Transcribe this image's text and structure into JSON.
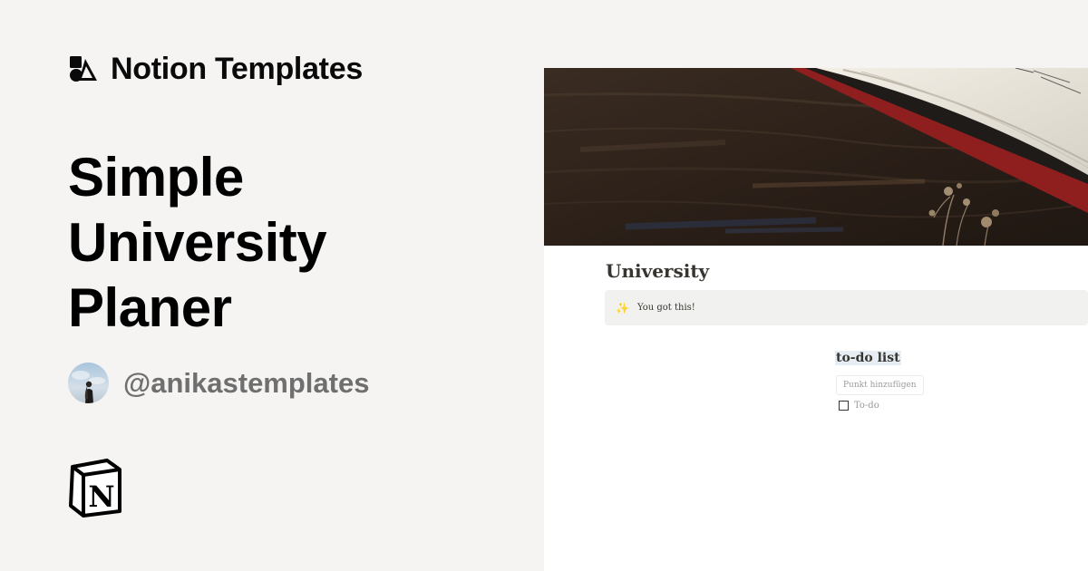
{
  "brand": {
    "name": "Notion Templates",
    "icon": "notion-templates-logo-icon"
  },
  "title": {
    "lines": [
      "Simple",
      "University",
      "Planer"
    ]
  },
  "author": {
    "handle": "@anikastemplates",
    "avatar": "author-avatar"
  },
  "logo": {
    "name": "notion-logo",
    "letter": "N"
  },
  "preview": {
    "page_title": "University",
    "callout": {
      "icon": "sparkles-icon",
      "text": "You got this!"
    },
    "todo": {
      "heading": "to-do list",
      "add_placeholder": "Punkt hinzufügen",
      "items": [
        {
          "label": "To-do",
          "checked": false
        }
      ]
    }
  },
  "colors": {
    "background": "#f5f4f2",
    "title_text": "#000000",
    "handle_text": "#6f6f6f",
    "notion_text": "#37352f",
    "callout_bg": "#f1f1ef",
    "heading_highlight": "#e7eef3"
  }
}
